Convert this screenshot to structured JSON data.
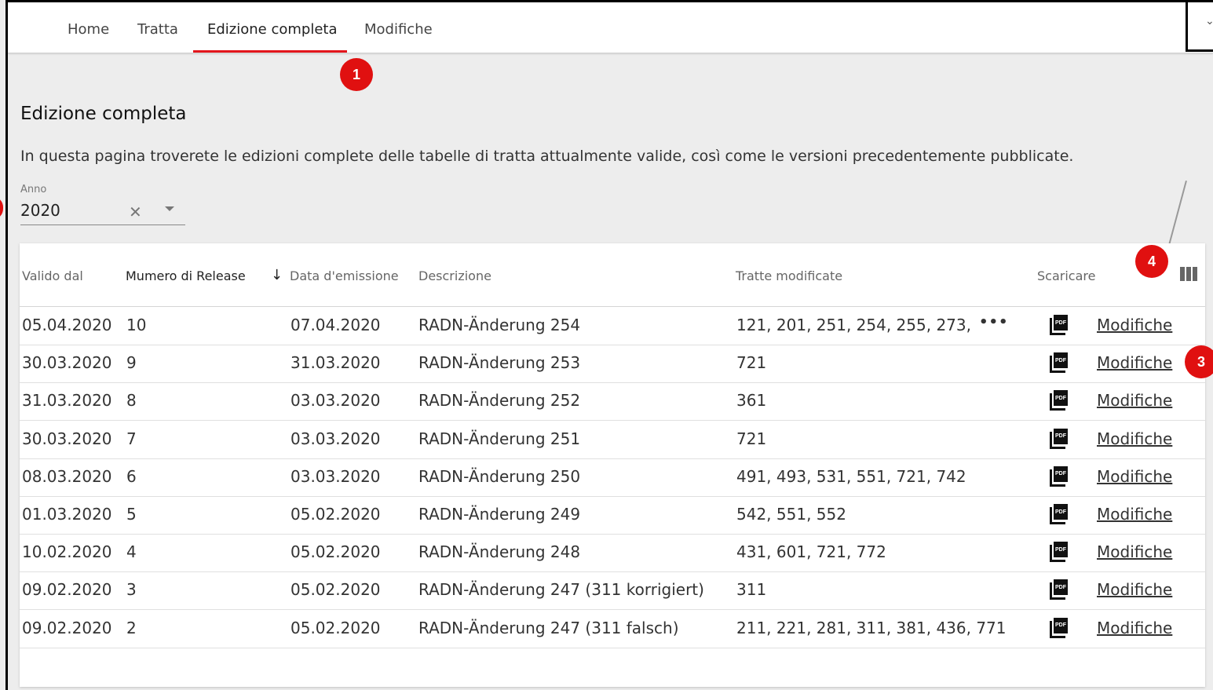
{
  "nav": {
    "items": [
      "Home",
      "Tratta",
      "Edizione completa",
      "Modifiche"
    ],
    "active": "Edizione completa"
  },
  "badges": {
    "b1": "1",
    "b3": "3",
    "b4": "4"
  },
  "page": {
    "title": "Edizione completa",
    "intro": "In questa pagina troverete le edizioni complete delle tabelle di tratta attualmente valide, così come le versioni precedentemente pubblicate."
  },
  "filter": {
    "label": "Anno",
    "value": "2020"
  },
  "table": {
    "headers": {
      "valid_from": "Valido dal",
      "release": "Mumero di Release",
      "issue_date": "Data d'emissione",
      "description": "Descrizione",
      "routes": "Tratte modificate",
      "download": "Scaricare"
    },
    "pdf_text": "PDF",
    "link_label": "Modifiche",
    "rows": [
      {
        "valid_from": "05.04.2020",
        "release": "10",
        "issue_date": "07.04.2020",
        "description": "RADN-Änderung 254",
        "routes": "121, 201, 251, 254, 255, 273,",
        "more": "•••"
      },
      {
        "valid_from": "30.03.2020",
        "release": "9",
        "issue_date": "31.03.2020",
        "description": "RADN-Änderung 253",
        "routes": "721"
      },
      {
        "valid_from": "31.03.2020",
        "release": "8",
        "issue_date": "03.03.2020",
        "description": "RADN-Änderung 252",
        "routes": "361"
      },
      {
        "valid_from": "30.03.2020",
        "release": "7",
        "issue_date": "03.03.2020",
        "description": "RADN-Änderung 251",
        "routes": "721"
      },
      {
        "valid_from": "08.03.2020",
        "release": "6",
        "issue_date": "03.03.2020",
        "description": "RADN-Änderung 250",
        "routes": "491, 493, 531, 551, 721, 742"
      },
      {
        "valid_from": "01.03.2020",
        "release": "5",
        "issue_date": "05.02.2020",
        "description": "RADN-Änderung 249",
        "routes": "542, 551, 552"
      },
      {
        "valid_from": "10.02.2020",
        "release": "4",
        "issue_date": "05.02.2020",
        "description": "RADN-Änderung 248",
        "routes": "431, 601, 721, 772"
      },
      {
        "valid_from": "09.02.2020",
        "release": "3",
        "issue_date": "05.02.2020",
        "description": "RADN-Änderung 247 (311 korrigiert)",
        "routes": "311"
      },
      {
        "valid_from": "09.02.2020",
        "release": "2",
        "issue_date": "05.02.2020",
        "description": "RADN-Änderung 247 (311 falsch)",
        "routes": "211, 221, 281, 311, 381, 436, 771"
      }
    ]
  },
  "colors": {
    "accent": "#e3161c",
    "badge": "#e01010"
  }
}
